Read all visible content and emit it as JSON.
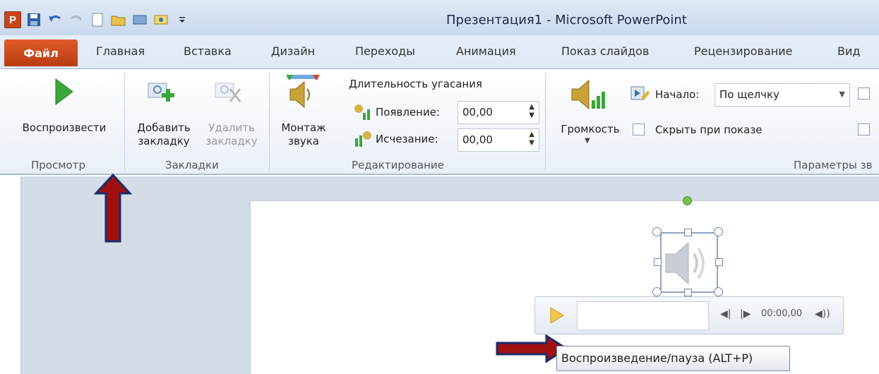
{
  "window": {
    "title": "Презентация1 - Microsoft PowerPoint"
  },
  "tabs": {
    "file": "Файл",
    "items": [
      "Главная",
      "Вставка",
      "Дизайн",
      "Переходы",
      "Анимация",
      "Показ слайдов",
      "Рецензирование",
      "Вид"
    ]
  },
  "ribbon": {
    "preview": {
      "play_label": "Воспроизвести",
      "group_label": "Просмотр"
    },
    "bookmarks": {
      "add_line1": "Добавить",
      "add_line2": "закладку",
      "remove_line1": "Удалить",
      "remove_line2": "закладку",
      "group_label": "Закладки"
    },
    "editing": {
      "trim_line1": "Монтаж",
      "trim_line2": "звука",
      "fade_title": "Длительность угасания",
      "fade_in_label": "Появление:",
      "fade_in_value": "00,00",
      "fade_out_label": "Исчезание:",
      "fade_out_value": "00,00",
      "group_label": "Редактирование"
    },
    "audio_options": {
      "volume_label": "Громкость",
      "start_label": "Начало:",
      "start_value": "По щелчку",
      "hide_label": "Скрыть при показе",
      "group_label": "Параметры зв"
    }
  },
  "player": {
    "time": "00:00,00"
  },
  "tooltip": {
    "text": "Воспроизведение/пауза (ALT+P)"
  },
  "colors": {
    "annotation_arrow": "#a01010",
    "file_tab": "#c9461a",
    "play_green": "#3aa839"
  },
  "icons": [
    "powerpoint-logo",
    "save-icon",
    "undo-icon",
    "redo-icon",
    "new-icon",
    "open-icon",
    "play-triangle-icon",
    "add-bookmark-icon",
    "remove-bookmark-icon",
    "trim-audio-icon",
    "fade-in-icon",
    "fade-out-icon",
    "volume-icon",
    "start-icon",
    "speaker-icon"
  ]
}
